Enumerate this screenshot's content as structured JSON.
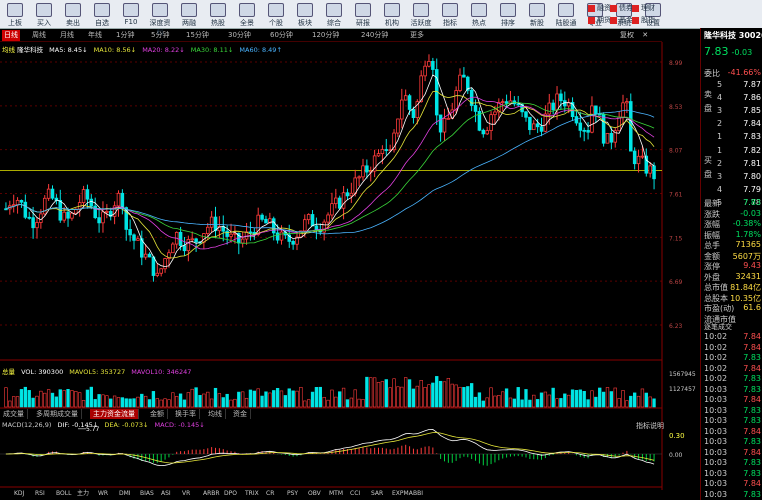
{
  "toolbar": {
    "items": [
      "上板",
      "买入",
      "卖出",
      "自选",
      "F10",
      "深度资料",
      "两融",
      "热股",
      "全景",
      "个股",
      "板块",
      "综合",
      "研报",
      "机构",
      "活跃度",
      "指标",
      "热点",
      "排序",
      "新股",
      "陆股通",
      "专业",
      "系统",
      "设置"
    ],
    "right_items": [
      "融资",
      "债券",
      "理财",
      "期货",
      "基金",
      "股指"
    ]
  },
  "period_tabs": [
    "日线",
    "周线",
    "月线",
    "年线",
    "1分钟",
    "5分钟",
    "15分钟",
    "30分钟",
    "60分钟",
    "120分钟",
    "240分钟",
    "更多"
  ],
  "active_period": "日线",
  "chart_toolbar_right": [
    "复权",
    "✕"
  ],
  "ma_legend": {
    "stock": "均线 ",
    "name": "隆华科技",
    "items": [
      {
        "text": "MA5: 8.45↓",
        "color": "#ffffff"
      },
      {
        "text": "MA10: 8.56↓",
        "color": "#e5e53a"
      },
      {
        "text": "MA20: 8.22↓",
        "color": "#e040e0"
      },
      {
        "text": "MA30: 8.11↓",
        "color": "#3ad63a"
      },
      {
        "text": "MA60: 8.49↑",
        "color": "#4ab4ff"
      }
    ]
  },
  "price_axis": [
    "8.99",
    "8.53",
    "8.07",
    "7.61",
    "7.15",
    "6.69",
    "6.23"
  ],
  "price_annotations": {
    "high": "9.54",
    "low": "5.77"
  },
  "volume_legend": {
    "label": "总量",
    "vol": "VOL: 390300",
    "ma5": "MAVOL5: 353727",
    "ma10": "MAVOL10: 346247",
    "axis": [
      "1567945",
      "1127457"
    ]
  },
  "indicator_tabs": [
    "成交量",
    "多周期成交量",
    "主力资金流量",
    "金额",
    "换手率",
    "均线",
    "资金"
  ],
  "active_indicator": "主力资金流量",
  "macd_legend": {
    "label": "MACD(12,26,9)",
    "dif": "DIF: -0.145↓",
    "dea": "DEA: -0.073↓",
    "macd": "MACD: -0.145↓",
    "right": "指标说明",
    "axis": [
      "0.30",
      "0.00"
    ]
  },
  "bottom_tabs": [
    "KDJ",
    "RSI",
    "BOLL",
    "主力",
    "WR",
    "DMI",
    "BIAS",
    "ASI",
    "VR",
    "ARBR",
    "DPO",
    "TRIX",
    "CR",
    "PSY",
    "OBV",
    "MTM",
    "CCI",
    "SAR",
    "EXPMA",
    "BBI"
  ],
  "month_labels": [
    "03",
    "04",
    "05",
    "06",
    "07",
    "08",
    "09",
    "10",
    "11"
  ],
  "right_panel": {
    "title": "隆华科技  300263",
    "price": "7.83",
    "change": "-0.03",
    "change_pct": "-0.38%",
    "order_label": "委比",
    "order_value": "-41.66%",
    "sell_label": "卖盘",
    "buy_label": "买盘",
    "sell_levels": [
      "7.87",
      "7.86",
      "7.85",
      "7.84",
      "7.83"
    ],
    "buy_levels": [
      "7.82",
      "7.81",
      "7.80",
      "7.79",
      "7.78"
    ],
    "stats": [
      {
        "label": "最新",
        "value": "7.83"
      },
      {
        "label": "涨跌",
        "value": "-0.03"
      },
      {
        "label": "涨幅",
        "value": "-0.38%"
      },
      {
        "label": "振幅",
        "value": "1.78%"
      },
      {
        "label": "总手",
        "value": "71365"
      },
      {
        "label": "金额",
        "value": "5607万"
      },
      {
        "label": "涨停",
        "value": "9.43"
      },
      {
        "label": "外盘",
        "value": "32431"
      },
      {
        "label": "总市值",
        "value": "81.84亿"
      },
      {
        "label": "总股本",
        "value": "10.35亿"
      },
      {
        "label": "市盈(动)",
        "value": "61.6"
      },
      {
        "label": "流通市值",
        "value": ""
      }
    ],
    "ticks_header": "逐笔成交",
    "ticks": [
      {
        "time": "10:02",
        "price": "7.84"
      },
      {
        "time": "10:02",
        "price": "7.84"
      },
      {
        "time": "10:02",
        "price": "7.83"
      },
      {
        "time": "10:02",
        "price": "7.84"
      },
      {
        "time": "10:02",
        "price": "7.83"
      },
      {
        "time": "10:03",
        "price": "7.83"
      },
      {
        "time": "10:03",
        "price": "7.84"
      },
      {
        "time": "10:03",
        "price": "7.83"
      },
      {
        "time": "10:03",
        "price": "7.83"
      },
      {
        "time": "10:03",
        "price": "7.84"
      },
      {
        "time": "10:03",
        "price": "7.83"
      },
      {
        "time": "10:03",
        "price": "7.84"
      },
      {
        "time": "10:03",
        "price": "7.83"
      },
      {
        "time": "10:03",
        "price": "7.83"
      },
      {
        "time": "10:03",
        "price": "7.84"
      },
      {
        "time": "10:03",
        "price": "7.83"
      }
    ]
  },
  "colors": {
    "up": "#ff3b3b",
    "down": "#00e5e5",
    "grid": "#5a0000",
    "hline": "#e6e600"
  }
}
